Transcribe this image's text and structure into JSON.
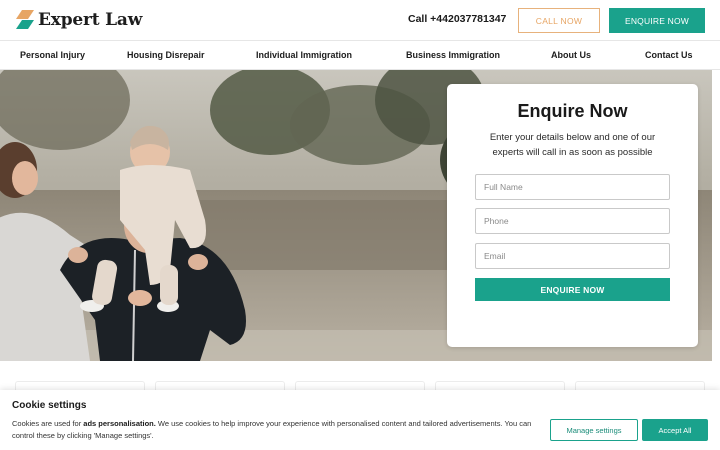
{
  "brand": {
    "name": "Expert Law",
    "accent": "#1aa28c",
    "secondary": "#e7a564"
  },
  "header": {
    "phone": "Call +442037781347",
    "call_button": "CALL NOW",
    "enquire_button": "ENQUIRE NOW"
  },
  "nav": {
    "items": [
      "Personal Injury",
      "Housing Disrepair",
      "Individual Immigration",
      "Business Immigration",
      "About Us",
      "Contact Us"
    ]
  },
  "hero": {
    "image": "family-outdoors-photo"
  },
  "enquiry": {
    "title": "Enquire Now",
    "subtitle": "Enter your details below and one of our experts will call in as soon as possible",
    "fields": {
      "name_placeholder": "Full Name",
      "phone_placeholder": "Phone",
      "email_placeholder": "Email"
    },
    "submit": "ENQUIRE NOW"
  },
  "cookie": {
    "title": "Cookie settings",
    "text_prefix": "Cookies are used for ",
    "text_bold": "ads personalisation.",
    "text_suffix": " We use cookies to help improve your experience with personalised content and tailored advertisements. You can control these by clicking 'Manage settings'.",
    "manage_button": "Manage settings",
    "accept_button": "Accept All"
  }
}
